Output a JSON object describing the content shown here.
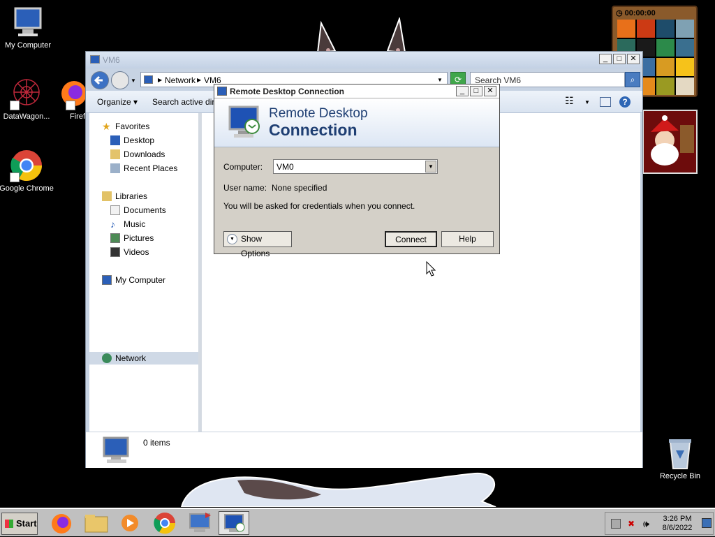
{
  "desktop": {
    "icons": [
      {
        "label": "My Computer"
      },
      {
        "label": "DataWagon..."
      },
      {
        "label": "Firef"
      },
      {
        "label": "Google Chrome"
      },
      {
        "label": "Recycle Bin"
      }
    ]
  },
  "puzzle": {
    "timer": "00:00:00"
  },
  "explorer": {
    "title": "VM6",
    "breadcrumb": [
      "Network",
      "VM6"
    ],
    "search_placeholder": "Search VM6",
    "toolbar": {
      "organize": "Organize",
      "search_ad": "Search active direc"
    },
    "nav": {
      "favorites": "Favorites",
      "desktop": "Desktop",
      "downloads": "Downloads",
      "recent": "Recent Places",
      "libraries": "Libraries",
      "documents": "Documents",
      "music": "Music",
      "pictures": "Pictures",
      "videos": "Videos",
      "computer": "My Computer",
      "network": "Network"
    },
    "details": {
      "count": "0 items"
    }
  },
  "rdc": {
    "title": "Remote Desktop Connection",
    "banner_line1": "Remote Desktop",
    "banner_line2": "Connection",
    "computer_label": "Computer:",
    "computer_value": "VM0",
    "username_label": "User name:",
    "username_value": "None specified",
    "note": "You will be asked for credentials when you connect.",
    "show_options": "Show Options",
    "connect": "Connect",
    "help": "Help"
  },
  "taskbar": {
    "start": "Start",
    "time": "3:26 PM",
    "date": "8/6/2022"
  }
}
